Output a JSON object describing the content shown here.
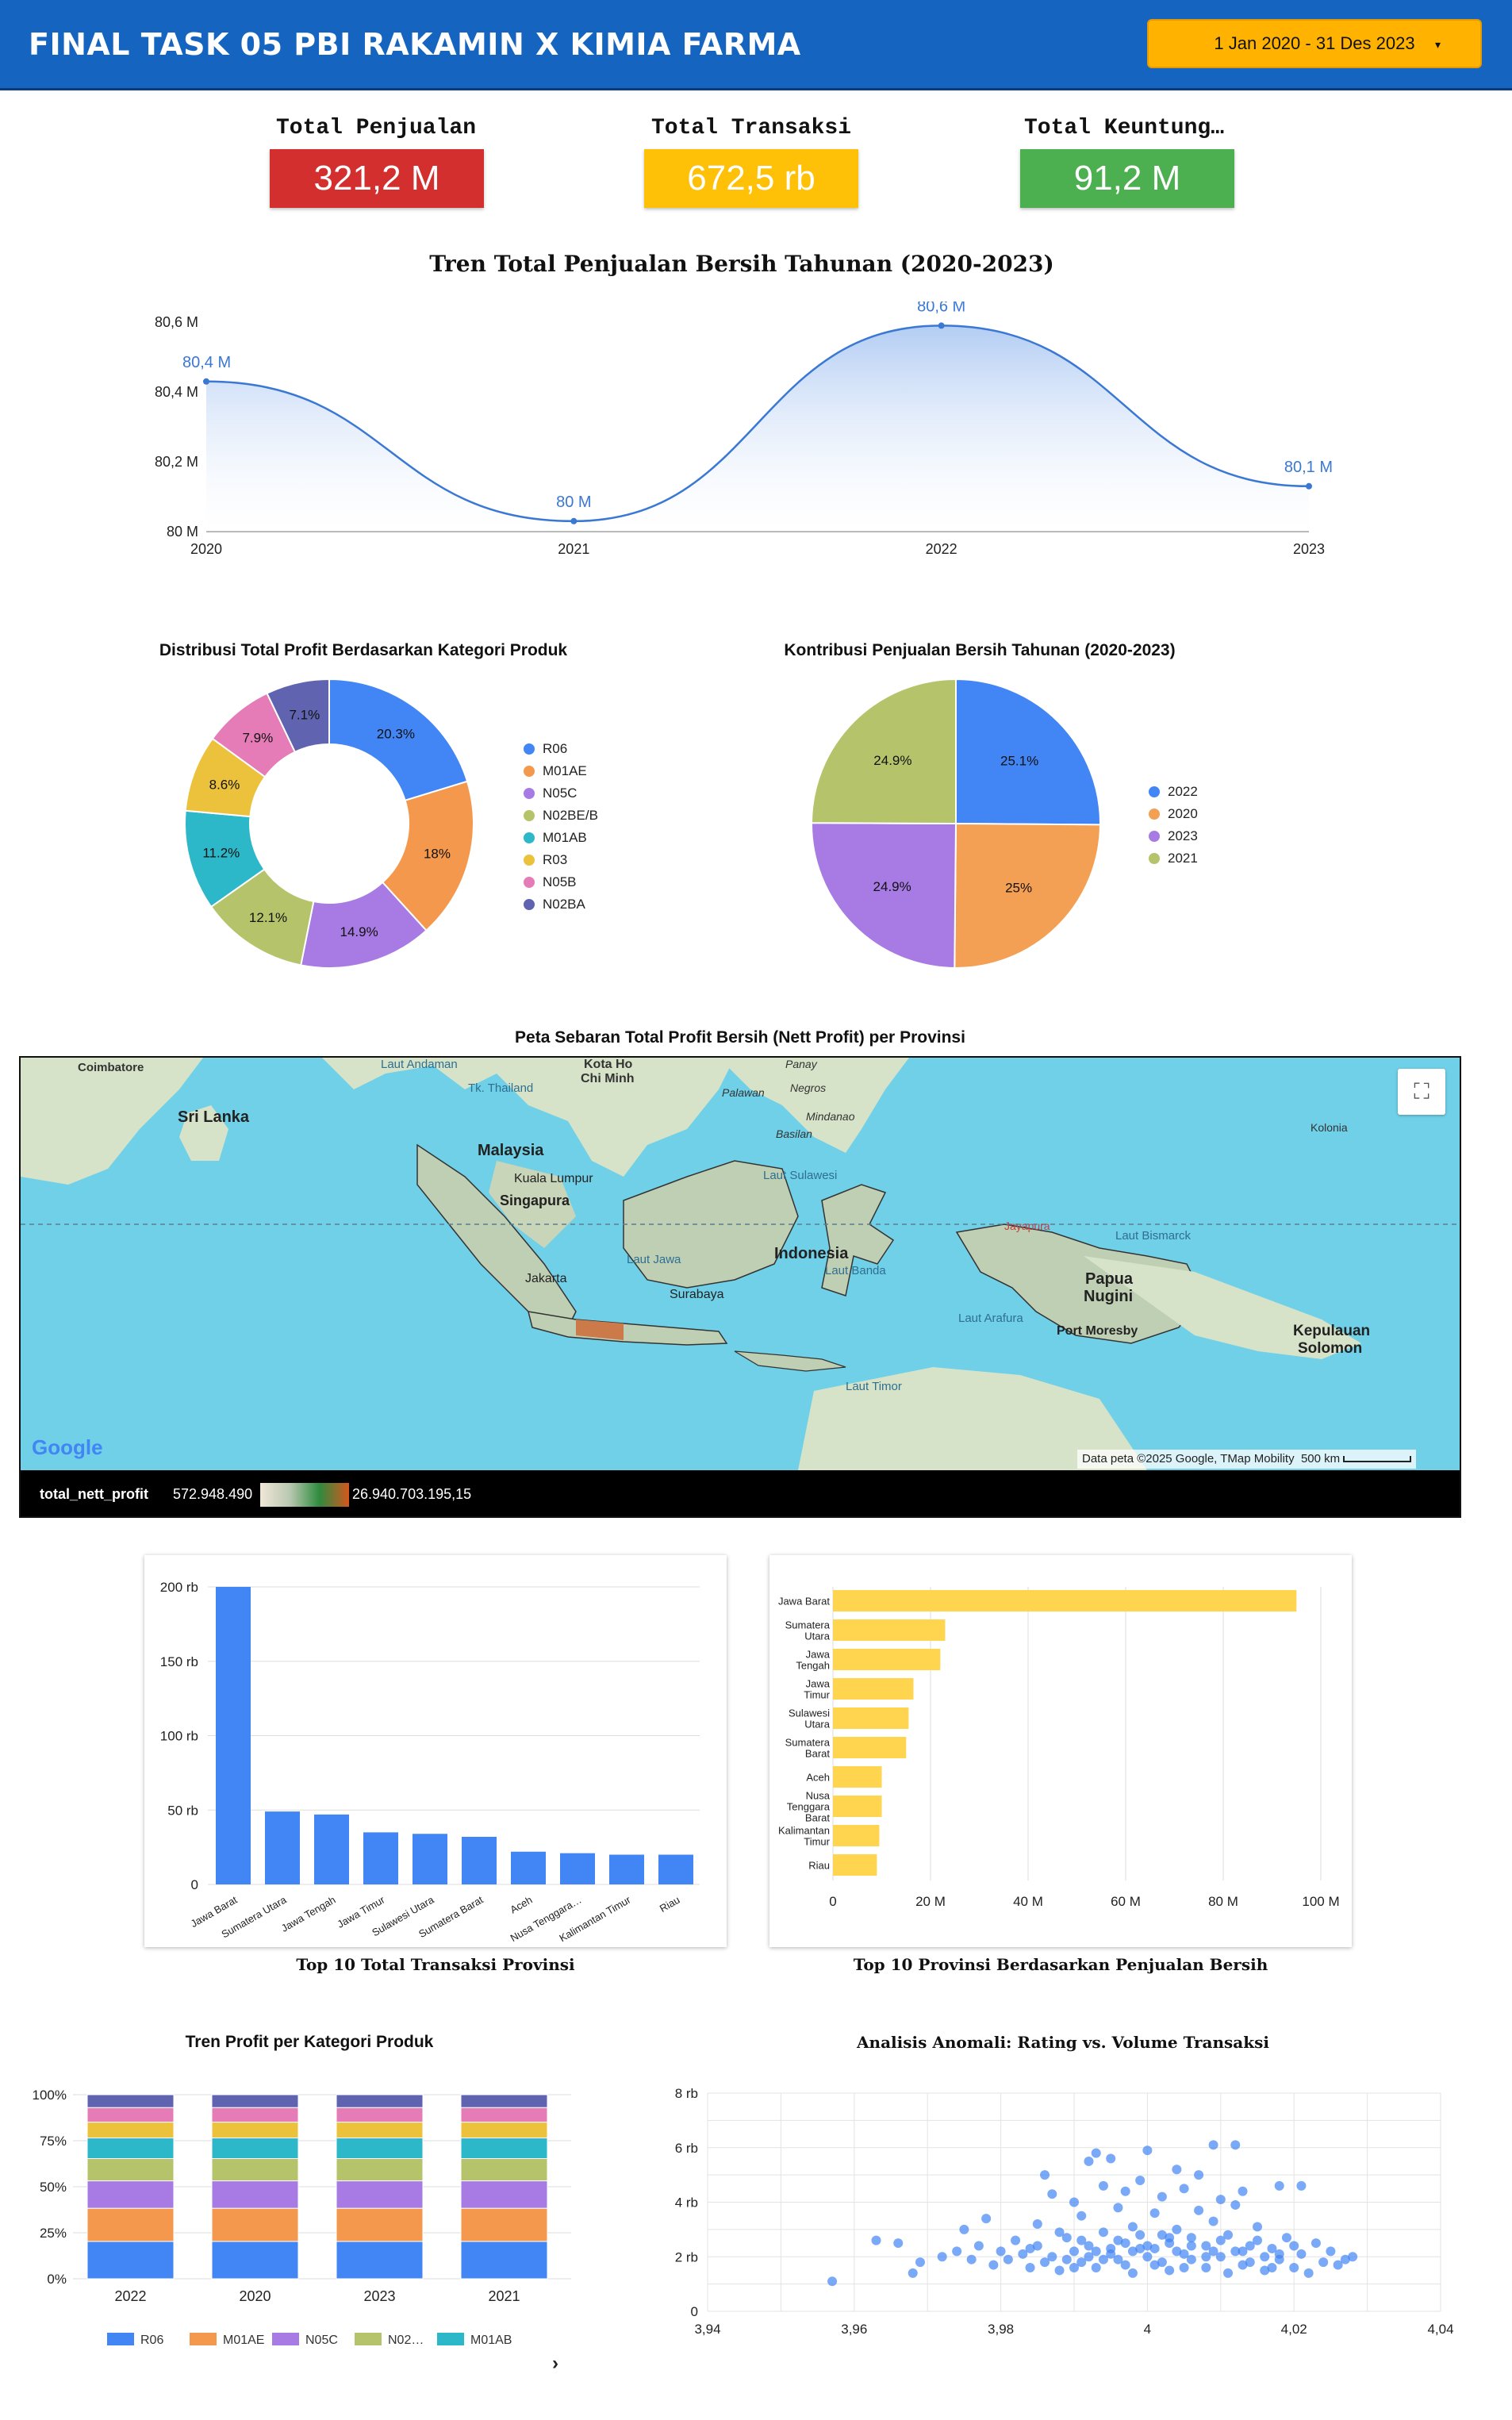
{
  "header": {
    "title": "FINAL TASK 05 PBI RAKAMIN X KIMIA FARMA",
    "date_range": "1 Jan 2020 - 31 Des 2023",
    "dropdown_icon": "caret-down-icon"
  },
  "kpis": [
    {
      "label": "Total Penjualan",
      "value": "321,2 M",
      "color": "#d32f2f"
    },
    {
      "label": "Total Transaksi",
      "value": "672,5 rb",
      "color": "#ffc107"
    },
    {
      "label": "Total Keuntung…",
      "value": "91,2 M",
      "color": "#4caf50"
    }
  ],
  "trend": {
    "title": "Tren Total Penjualan Bersih Tahunan (2020-2023)",
    "chart_data": {
      "type": "area",
      "x": [
        "2020",
        "2021",
        "2022",
        "2023"
      ],
      "values": [
        80.43,
        80.03,
        80.59,
        80.13
      ],
      "labels": [
        "80,4 M",
        "80 M",
        "80,6 M",
        "80,1 M"
      ],
      "yticks": [
        "80 M",
        "80,2 M",
        "80,4 M",
        "80,6 M"
      ],
      "ylim": [
        80.0,
        80.6
      ],
      "color": "#3a78d4"
    }
  },
  "donut": {
    "title": "Distribusi Total Profit Berdasarkan Kategori Produk",
    "chart_data": {
      "type": "pie",
      "categories": [
        "R06",
        "M01AE",
        "N05C",
        "N02BE/B",
        "M01AB",
        "R03",
        "N05B",
        "N02BA"
      ],
      "values": [
        20.3,
        18.0,
        14.9,
        12.1,
        11.2,
        8.6,
        7.9,
        7.1
      ],
      "labels": [
        "20.3%",
        "18%",
        "14.9%",
        "12.1%",
        "11.2%",
        "8.6%",
        "7.9%",
        "7.1%"
      ],
      "colors": [
        "#4285f4",
        "#f4984e",
        "#a77be3",
        "#b5c46a",
        "#2cb8c9",
        "#ecc13c",
        "#e57cb8",
        "#6063b0"
      ]
    }
  },
  "pie": {
    "title": "Kontribusi Penjualan Bersih Tahunan (2020-2023)",
    "chart_data": {
      "type": "pie",
      "categories": [
        "2022",
        "2020",
        "2023",
        "2021"
      ],
      "values": [
        25.1,
        25.0,
        24.9,
        24.9
      ],
      "labels": [
        "25.1%",
        "25%",
        "24.9%",
        "24.9%"
      ],
      "colors": [
        "#4285f4",
        "#f4a054",
        "#a77be3",
        "#b5c46a"
      ]
    }
  },
  "map": {
    "title": "Peta Sebaran Total Profit Bersih (Nett Profit) per Provinsi",
    "labels": {
      "coimbatore": "Coimbatore",
      "sri_lanka": "Sri Lanka",
      "laut_andaman": "Laut Andaman",
      "thailand": "Tk. Thailand",
      "kota_hcm": "Kota Ho",
      "chi_minh": "Chi Minh",
      "palawan": "Palawan",
      "panay": "Panay",
      "negros": "Negros",
      "mindanao": "Mindanao",
      "basilan": "Basilan",
      "malaysia": "Malaysia",
      "kuala_lumpur": "Kuala Lumpur",
      "singapura": "Singapura",
      "laut_sulawesi": "Laut Sulawesi",
      "kolonia": "Kolonia",
      "indonesia": "Indonesia",
      "laut_jawa": "Laut Jawa",
      "laut_banda": "Laut Banda",
      "jakarta": "Jakarta",
      "surabaya": "Surabaya",
      "jayapura": "Jayapura",
      "laut_bismarck": "Laut Bismarck",
      "papua": "Papua",
      "nugini": "Nugini",
      "laut_arafura": "Laut Arafura",
      "port_moresby": "Port Moresby",
      "kepulauan": "Kepulauan",
      "solomon": "Solomon",
      "laut_timor": "Laut Timor",
      "google": "Google",
      "attribution": "Data peta ©2025 Google, TMap Mobility",
      "scale": "500 km"
    },
    "legend": {
      "field": "total_nett_profit",
      "min": "572.948.490",
      "max": "26.940.703.195,15"
    },
    "fullscreen_icon": "fullscreen-icon"
  },
  "bar_tx": {
    "title": "Top 10 Total Transaksi Provinsi",
    "chart_data": {
      "type": "bar",
      "categories": [
        "Jawa Barat",
        "Sumatera Utara",
        "Jawa Tengah",
        "Jawa Timur",
        "Sulawesi Utara",
        "Sumatera Barat",
        "Aceh",
        "Nusa Tenggara…",
        "Kalimantan Timur",
        "Riau"
      ],
      "values": [
        200,
        49,
        47,
        35,
        34,
        32,
        22,
        21,
        20,
        20
      ],
      "yticks": [
        "0",
        "50 rb",
        "100 rb",
        "150 rb",
        "200 rb"
      ],
      "ylim": [
        0,
        200
      ],
      "color": "#4285f4"
    }
  },
  "bar_sales": {
    "title": "Top 10 Provinsi Berdasarkan Penjualan Bersih",
    "chart_data": {
      "type": "bar",
      "categories": [
        [
          "Jawa Barat"
        ],
        [
          "Sumatera",
          "Utara"
        ],
        [
          "Jawa",
          "Tengah"
        ],
        [
          "Jawa",
          "Timur"
        ],
        [
          "Sulawesi",
          "Utara"
        ],
        [
          "Sumatera",
          "Barat"
        ],
        [
          "Aceh"
        ],
        [
          "Nusa",
          "Tenggara",
          "Barat"
        ],
        [
          "Kalimantan",
          "Timur"
        ],
        [
          "Riau"
        ]
      ],
      "values": [
        95,
        23,
        22,
        16.5,
        15.5,
        15,
        10,
        10,
        9.5,
        9
      ],
      "xticks": [
        "0",
        "20 M",
        "40 M",
        "60 M",
        "80 M",
        "100 M"
      ],
      "xlim": [
        0,
        100
      ],
      "color": "#ffd54f"
    }
  },
  "stacked": {
    "title": "Tren Profit per Kategori Produk",
    "chart_data": {
      "type": "bar",
      "categories": [
        "2022",
        "2020",
        "2023",
        "2021"
      ],
      "yticks": [
        "0%",
        "25%",
        "50%",
        "75%",
        "100%"
      ],
      "series": [
        {
          "name": "R06",
          "color": "#4285f4",
          "values": [
            20.3,
            20.3,
            20.3,
            20.3
          ]
        },
        {
          "name": "M01AE",
          "color": "#f4984e",
          "values": [
            18,
            18,
            18,
            18
          ]
        },
        {
          "name": "N05C",
          "color": "#a77be3",
          "values": [
            14.9,
            14.9,
            14.9,
            14.9
          ]
        },
        {
          "name": "N02…",
          "color": "#b5c46a",
          "values": [
            12.1,
            12.1,
            12.1,
            12.1
          ]
        },
        {
          "name": "M01AB",
          "color": "#2cb8c9",
          "values": [
            11.2,
            11.2,
            11.2,
            11.2
          ]
        },
        {
          "name": "",
          "color": "#ecc13c",
          "values": [
            8.6,
            8.6,
            8.6,
            8.6
          ]
        },
        {
          "name": "",
          "color": "#e57cb8",
          "values": [
            7.9,
            7.9,
            7.9,
            7.9
          ]
        },
        {
          "name": "",
          "color": "#6063b0",
          "values": [
            7.0,
            7.0,
            7.0,
            7.0
          ]
        }
      ],
      "legend_next_icon": "chevron-right-icon"
    }
  },
  "scatter": {
    "title": "Analisis Anomali: Rating vs. Volume Transaksi",
    "chart_data": {
      "type": "scatter",
      "xticks": [
        "3,94",
        "3,96",
        "3,98",
        "4",
        "4,02",
        "4,04"
      ],
      "yticks": [
        "0",
        "2 rb",
        "4 rb",
        "6 rb",
        "8 rb"
      ],
      "xlim": [
        3.94,
        4.04
      ],
      "ylim": [
        0,
        8
      ],
      "color": "#4285f4",
      "points": [
        [
          3.957,
          1.1
        ],
        [
          3.963,
          2.6
        ],
        [
          3.966,
          2.5
        ],
        [
          3.968,
          1.4
        ],
        [
          3.969,
          1.8
        ],
        [
          3.972,
          2.0
        ],
        [
          3.974,
          2.2
        ],
        [
          3.975,
          3.0
        ],
        [
          3.976,
          1.9
        ],
        [
          3.977,
          2.4
        ],
        [
          3.978,
          3.4
        ],
        [
          3.979,
          1.7
        ],
        [
          3.98,
          2.2
        ],
        [
          3.981,
          1.9
        ],
        [
          3.982,
          2.6
        ],
        [
          3.983,
          2.1
        ],
        [
          3.984,
          1.6
        ],
        [
          3.985,
          2.4
        ],
        [
          3.985,
          3.2
        ],
        [
          3.986,
          5.0
        ],
        [
          3.987,
          4.3
        ],
        [
          3.987,
          2.0
        ],
        [
          3.988,
          1.5
        ],
        [
          3.989,
          2.7
        ],
        [
          3.99,
          2.2
        ],
        [
          3.99,
          4.0
        ],
        [
          3.991,
          1.8
        ],
        [
          3.991,
          3.5
        ],
        [
          3.992,
          5.5
        ],
        [
          3.992,
          2.4
        ],
        [
          3.993,
          5.8
        ],
        [
          3.993,
          1.6
        ],
        [
          3.994,
          2.9
        ],
        [
          3.994,
          4.6
        ],
        [
          3.995,
          5.6
        ],
        [
          3.995,
          2.1
        ],
        [
          3.996,
          1.9
        ],
        [
          3.996,
          3.8
        ],
        [
          3.997,
          2.5
        ],
        [
          3.997,
          4.4
        ],
        [
          3.998,
          1.4
        ],
        [
          3.998,
          3.1
        ],
        [
          3.999,
          2.3
        ],
        [
          3.999,
          4.8
        ],
        [
          4.0,
          5.9
        ],
        [
          4.0,
          2.0
        ],
        [
          4.001,
          1.7
        ],
        [
          4.001,
          3.6
        ],
        [
          4.002,
          2.8
        ],
        [
          4.002,
          4.2
        ],
        [
          4.003,
          1.5
        ],
        [
          4.003,
          2.5
        ],
        [
          4.004,
          5.2
        ],
        [
          4.004,
          3.0
        ],
        [
          4.005,
          2.1
        ],
        [
          4.005,
          4.5
        ],
        [
          4.006,
          1.9
        ],
        [
          4.006,
          2.7
        ],
        [
          4.007,
          3.7
        ],
        [
          4.007,
          5.0
        ],
        [
          4.008,
          1.6
        ],
        [
          4.008,
          2.4
        ],
        [
          4.009,
          6.1
        ],
        [
          4.009,
          3.3
        ],
        [
          4.01,
          2.0
        ],
        [
          4.01,
          4.1
        ],
        [
          4.011,
          1.4
        ],
        [
          4.011,
          2.8
        ],
        [
          4.012,
          3.9
        ],
        [
          4.012,
          6.1
        ],
        [
          4.013,
          2.2
        ],
        [
          4.013,
          4.4
        ],
        [
          4.014,
          1.8
        ],
        [
          4.015,
          2.6
        ],
        [
          4.015,
          3.1
        ],
        [
          4.016,
          1.5
        ],
        [
          4.017,
          2.3
        ],
        [
          4.018,
          4.6
        ],
        [
          4.018,
          1.9
        ],
        [
          4.019,
          2.7
        ],
        [
          4.02,
          1.6
        ],
        [
          4.021,
          2.1
        ],
        [
          4.021,
          4.6
        ],
        [
          4.022,
          1.4
        ],
        [
          4.023,
          2.5
        ],
        [
          4.024,
          1.8
        ],
        [
          4.025,
          2.2
        ],
        [
          4.026,
          1.7
        ],
        [
          4.027,
          1.9
        ],
        [
          4.028,
          2.0
        ],
        [
          3.984,
          2.3
        ],
        [
          3.986,
          1.8
        ],
        [
          3.988,
          2.9
        ],
        [
          3.99,
          1.6
        ],
        [
          3.992,
          2.0
        ],
        [
          3.994,
          1.9
        ],
        [
          3.996,
          2.6
        ],
        [
          3.998,
          2.2
        ],
        [
          4.0,
          2.4
        ],
        [
          4.002,
          1.8
        ],
        [
          4.004,
          2.2
        ],
        [
          4.006,
          2.4
        ],
        [
          4.008,
          2.0
        ],
        [
          4.01,
          2.6
        ],
        [
          4.012,
          2.2
        ],
        [
          4.014,
          2.4
        ],
        [
          4.016,
          2.0
        ],
        [
          4.018,
          2.1
        ],
        [
          4.02,
          2.4
        ],
        [
          3.989,
          1.9
        ],
        [
          3.993,
          2.2
        ],
        [
          3.997,
          1.7
        ],
        [
          4.001,
          2.3
        ],
        [
          4.005,
          1.6
        ],
        [
          4.009,
          2.2
        ],
        [
          4.013,
          1.7
        ],
        [
          4.017,
          1.6
        ],
        [
          4.003,
          2.7
        ],
        [
          3.999,
          2.8
        ],
        [
          3.995,
          2.3
        ],
        [
          3.991,
          2.6
        ]
      ]
    }
  }
}
